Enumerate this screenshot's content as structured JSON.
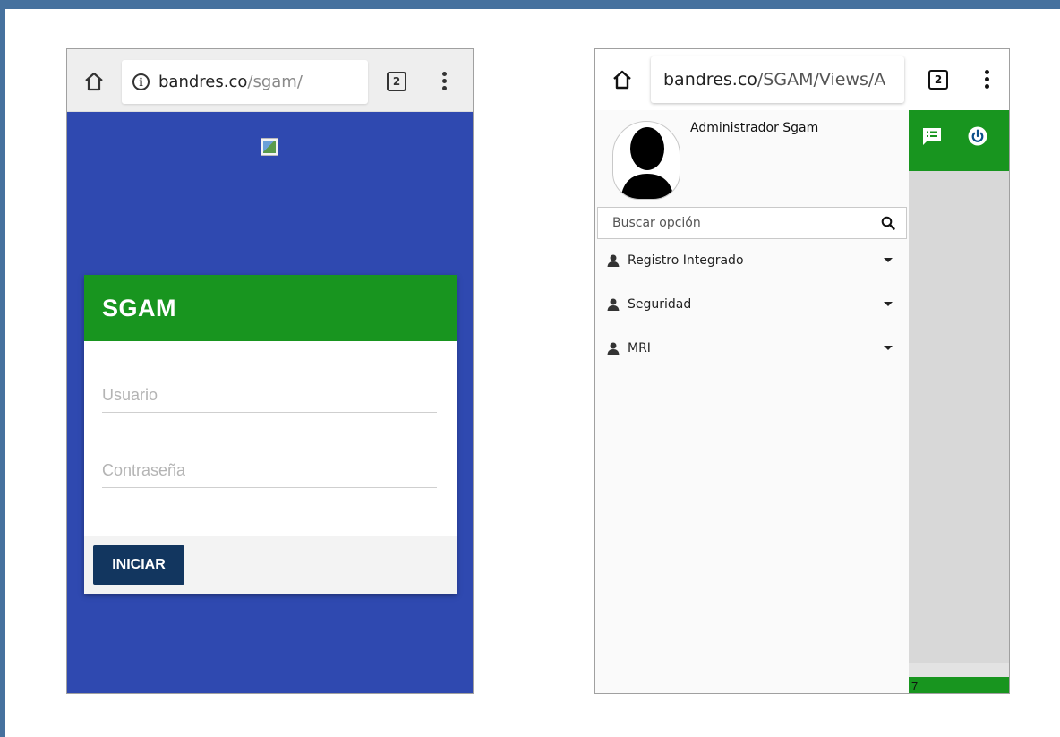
{
  "phone1": {
    "url_domain": "bandres.co",
    "url_path": "/sgam/",
    "info_glyph": "i",
    "tab_count": "2",
    "login": {
      "title": "SGAM",
      "username_placeholder": "Usuario",
      "password_placeholder": "Contraseña",
      "submit_label": "INICIAR"
    },
    "colors": {
      "background": "#2f49b0",
      "header": "#18951f",
      "button": "#12365f"
    },
    "icons": [
      "home-icon",
      "info-icon",
      "tabs-icon",
      "overflow-menu-icon",
      "broken-image-icon"
    ]
  },
  "phone2": {
    "url_domain": "bandres.co",
    "url_path": "/SGAM/Views/A",
    "tab_count": "2",
    "user_name": "Administrador Sgam",
    "search_placeholder": "Buscar opción",
    "menu_items": [
      {
        "label": "Registro Integrado"
      },
      {
        "label": "Seguridad"
      },
      {
        "label": "MRI"
      }
    ],
    "footer_text": "7",
    "colors": {
      "accent": "#18951f",
      "power_icon": "#0b4f8a"
    },
    "icons": [
      "home-icon",
      "tabs-icon",
      "overflow-menu-icon",
      "avatar-silhouette-icon",
      "search-icon",
      "user-icon",
      "caret-down-icon",
      "message-list-icon",
      "power-icon"
    ]
  }
}
